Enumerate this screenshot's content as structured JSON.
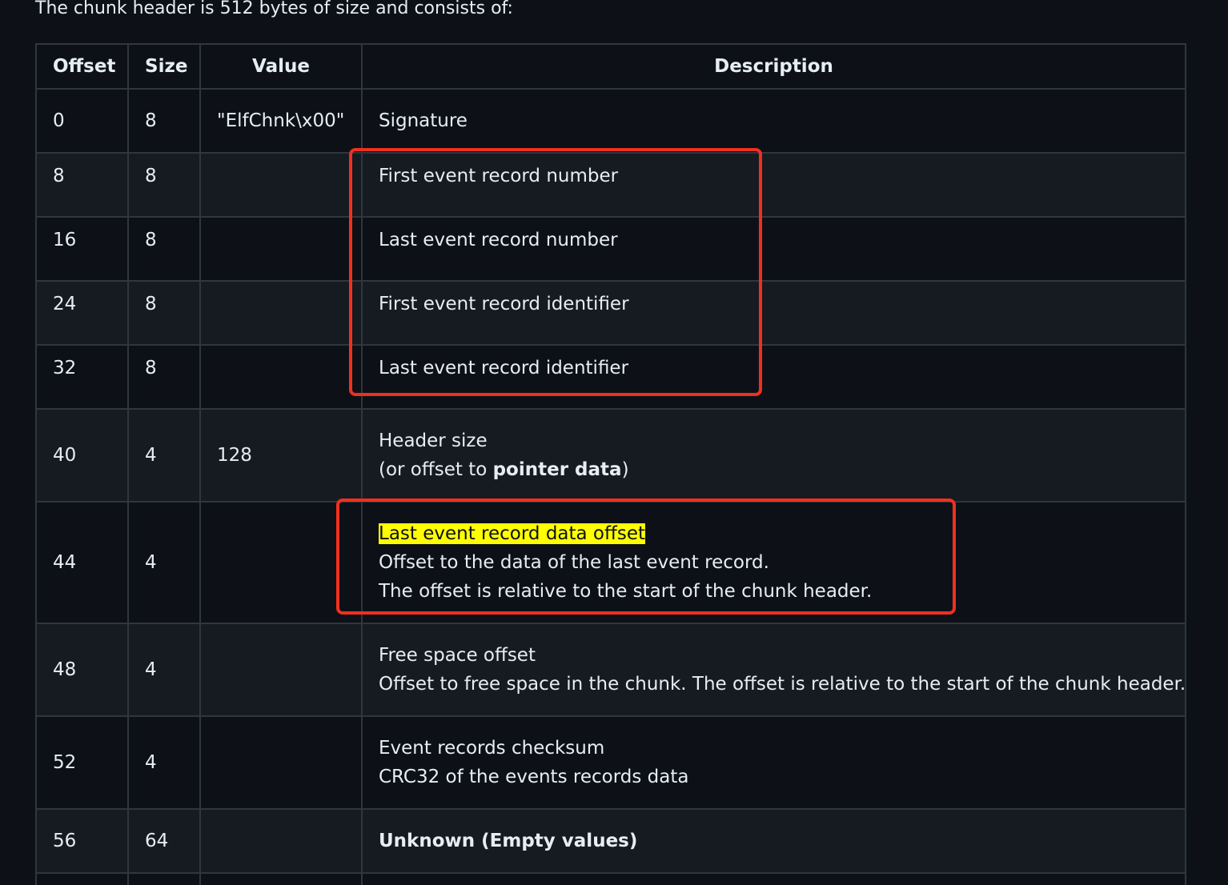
{
  "intro": "The chunk header is 512 bytes of size and consists of:",
  "headers": {
    "offset": "Offset",
    "size": "Size",
    "value": "Value",
    "description": "Description"
  },
  "rows": [
    {
      "offset": "0",
      "size": "8",
      "value": "\"ElfChnk\\x00\"",
      "desc1": "Signature"
    },
    {
      "offset": "8",
      "size": "8",
      "value": "",
      "desc1": "First event record number"
    },
    {
      "offset": "16",
      "size": "8",
      "value": "",
      "desc1": "Last event record number"
    },
    {
      "offset": "24",
      "size": "8",
      "value": "",
      "desc1": "First event record identifier"
    },
    {
      "offset": "32",
      "size": "8",
      "value": "",
      "desc1": "Last event record identifier"
    },
    {
      "offset": "40",
      "size": "4",
      "value": "128",
      "desc1": "Header size",
      "desc2_pre": "(or offset to ",
      "desc2_bold": "pointer data",
      "desc2_post": ")"
    },
    {
      "offset": "44",
      "size": "4",
      "value": "",
      "desc1": "Last event record data offset",
      "desc2": "Offset to the data of the last event record.",
      "desc3": "The offset is relative to the start of the chunk header."
    },
    {
      "offset": "48",
      "size": "4",
      "value": "",
      "desc1": "Free space offset",
      "desc2": "Offset to free space in the chunk. The offset is relative to the start of the chunk header."
    },
    {
      "offset": "52",
      "size": "4",
      "value": "",
      "desc1": "Event records checksum",
      "desc2": "CRC32 of the events records data"
    },
    {
      "offset": "56",
      "size": "64",
      "value": "",
      "desc1": "Unknown (Empty values)"
    }
  ],
  "colors": {
    "background": "#0d1117",
    "row_alt": "#161b22",
    "border": "#30363d",
    "annotation": "#f0301f",
    "highlight": "#ffff00"
  }
}
